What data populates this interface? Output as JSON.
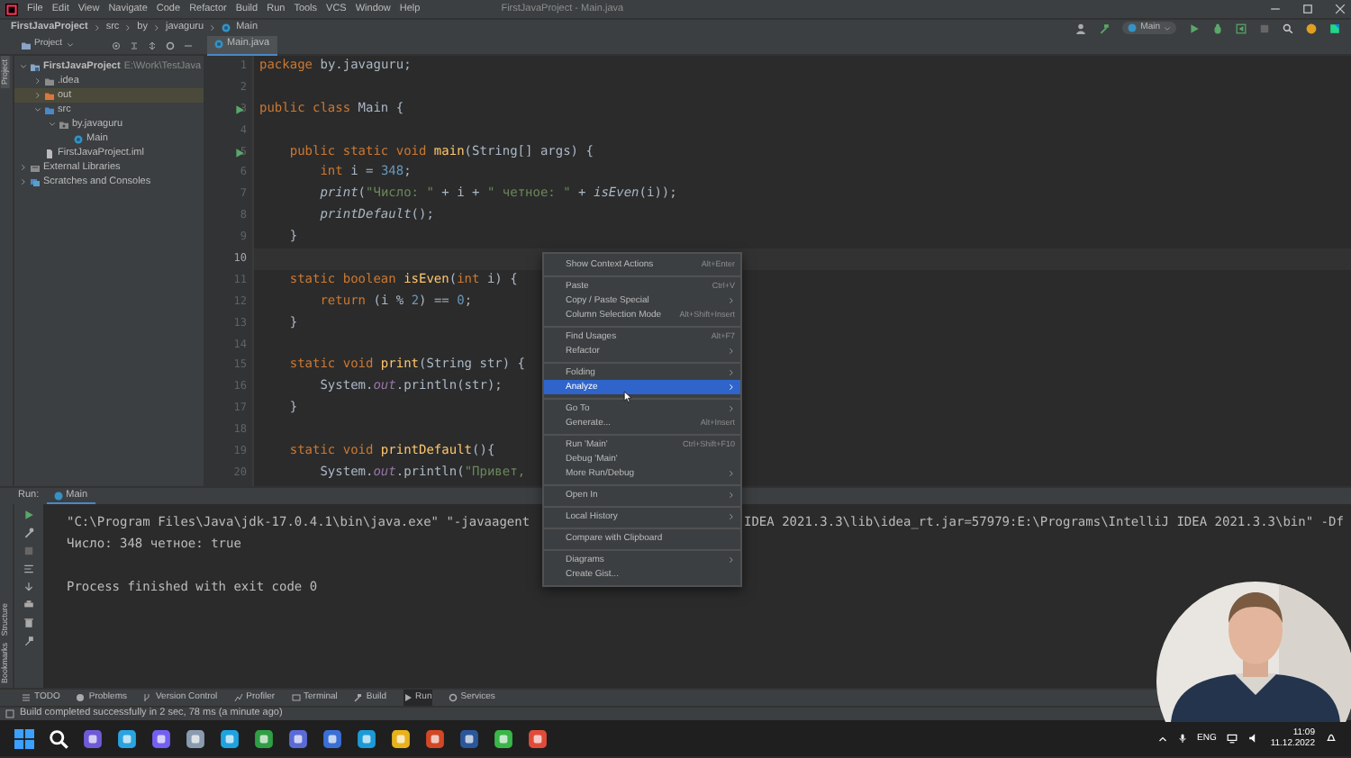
{
  "window": {
    "title": "FirstJavaProject - Main.java"
  },
  "menu": [
    "File",
    "Edit",
    "View",
    "Navigate",
    "Code",
    "Refactor",
    "Build",
    "Run",
    "Tools",
    "VCS",
    "Window",
    "Help"
  ],
  "breadcrumbs": [
    "FirstJavaProject",
    "src",
    "by",
    "javaguru",
    "Main"
  ],
  "run_config": "Main",
  "project_panel": {
    "label": "Project",
    "side_label": "Project",
    "tree": [
      {
        "name": "FirstJavaProject",
        "path": "E:\\Work\\TestJava",
        "kind": "module",
        "expanded": true,
        "selected": false,
        "children": [
          {
            "name": ".idea",
            "kind": "folder",
            "expanded": false,
            "selected": false
          },
          {
            "name": "out",
            "kind": "excluded",
            "expanded": false,
            "selected": true
          },
          {
            "name": "src",
            "kind": "source",
            "expanded": true,
            "selected": false,
            "children": [
              {
                "name": "by.javaguru",
                "kind": "package",
                "expanded": true,
                "selected": false,
                "children": [
                  {
                    "name": "Main",
                    "kind": "class",
                    "selected": false
                  }
                ]
              }
            ]
          },
          {
            "name": "FirstJavaProject.iml",
            "kind": "file",
            "selected": false
          }
        ]
      },
      {
        "name": "External Libraries",
        "kind": "library",
        "expanded": false,
        "selected": false
      },
      {
        "name": "Scratches and Consoles",
        "kind": "scratch",
        "expanded": false,
        "selected": false
      }
    ]
  },
  "editor": {
    "tab": {
      "label": "Main.java",
      "selected": true
    },
    "lines": [
      {
        "number": "1",
        "current": false,
        "run": false,
        "code": [
          {
            "kind": "kw",
            "text": "package"
          },
          {
            "kind": "plain",
            "text": " by.javaguru;"
          }
        ]
      },
      {
        "number": "2",
        "current": false,
        "run": false
      },
      {
        "number": "3",
        "current": false,
        "run": true,
        "code": [
          {
            "kind": "kw",
            "text": "public class"
          },
          {
            "kind": "plain",
            "text": " Main {"
          }
        ]
      },
      {
        "number": "4",
        "current": false,
        "run": false
      },
      {
        "number": "5",
        "current": false,
        "run": true,
        "code": [
          {
            "kind": "kw",
            "text": "    public static void"
          },
          {
            "kind": "fn",
            "text": " main"
          },
          {
            "kind": "plain",
            "text": "(String[] args) {"
          }
        ]
      },
      {
        "number": "6",
        "current": false,
        "run": false,
        "code": [
          {
            "kind": "kw",
            "text": "        int"
          },
          {
            "kind": "plain",
            "text": " i = "
          },
          {
            "kind": "num",
            "text": "348"
          },
          {
            "kind": "plain",
            "text": ";"
          }
        ]
      },
      {
        "number": "7",
        "current": false,
        "run": false,
        "code": [
          {
            "kind": "call",
            "text": "        print"
          },
          {
            "kind": "plain",
            "text": "("
          },
          {
            "kind": "str",
            "text": "\"Число: \""
          },
          {
            "kind": "plain",
            "text": " + i + "
          },
          {
            "kind": "str",
            "text": "\" четное: \""
          },
          {
            "kind": "plain",
            "text": " + "
          },
          {
            "kind": "call",
            "text": "isEven"
          },
          {
            "kind": "plain",
            "text": "(i));"
          }
        ]
      },
      {
        "number": "8",
        "current": false,
        "run": false,
        "code": [
          {
            "kind": "call",
            "text": "        printDefault"
          },
          {
            "kind": "plain",
            "text": "();"
          }
        ]
      },
      {
        "number": "9",
        "current": false,
        "run": false,
        "code": [
          {
            "kind": "plain",
            "text": "    }"
          }
        ]
      },
      {
        "number": "10",
        "current": true,
        "run": false
      },
      {
        "number": "11",
        "current": false,
        "run": false,
        "code": [
          {
            "kind": "kw",
            "text": "    static boolean"
          },
          {
            "kind": "fn",
            "text": " isEven"
          },
          {
            "kind": "plain",
            "text": "("
          },
          {
            "kind": "kw",
            "text": "int"
          },
          {
            "kind": "plain",
            "text": " i) {"
          }
        ]
      },
      {
        "number": "12",
        "current": false,
        "run": false,
        "code": [
          {
            "kind": "kw",
            "text": "        return"
          },
          {
            "kind": "plain",
            "text": " (i % "
          },
          {
            "kind": "num",
            "text": "2"
          },
          {
            "kind": "plain",
            "text": ") == "
          },
          {
            "kind": "num",
            "text": "0"
          },
          {
            "kind": "plain",
            "text": ";"
          }
        ]
      },
      {
        "number": "13",
        "current": false,
        "run": false,
        "code": [
          {
            "kind": "plain",
            "text": "    }"
          }
        ]
      },
      {
        "number": "14",
        "current": false,
        "run": false
      },
      {
        "number": "15",
        "current": false,
        "run": false,
        "code": [
          {
            "kind": "kw",
            "text": "    static void"
          },
          {
            "kind": "fn",
            "text": " print"
          },
          {
            "kind": "plain",
            "text": "(String str) {"
          }
        ]
      },
      {
        "number": "16",
        "current": false,
        "run": false,
        "code": [
          {
            "kind": "plain",
            "text": "        System."
          },
          {
            "kind": "field",
            "text": "out"
          },
          {
            "kind": "plain",
            "text": ".println(str);"
          }
        ]
      },
      {
        "number": "17",
        "current": false,
        "run": false,
        "code": [
          {
            "kind": "plain",
            "text": "    }"
          }
        ]
      },
      {
        "number": "18",
        "current": false,
        "run": false
      },
      {
        "number": "19",
        "current": false,
        "run": false,
        "code": [
          {
            "kind": "kw",
            "text": "    static void"
          },
          {
            "kind": "fn",
            "text": " printDefault"
          },
          {
            "kind": "plain",
            "text": "(){"
          }
        ]
      },
      {
        "number": "20",
        "current": false,
        "run": false,
        "code": [
          {
            "kind": "plain",
            "text": "        System."
          },
          {
            "kind": "field",
            "text": "out"
          },
          {
            "kind": "plain",
            "text": ".println("
          },
          {
            "kind": "str",
            "text": "\"Привет, "
          }
        ]
      }
    ]
  },
  "context_menu": {
    "items": [
      {
        "kind": "item",
        "label": "Show Context Actions",
        "shortcut": "Alt+Enter",
        "submenu": false,
        "selected": false
      },
      {
        "kind": "separator"
      },
      {
        "kind": "item",
        "label": "Paste",
        "shortcut": "Ctrl+V",
        "submenu": false,
        "selected": false
      },
      {
        "kind": "item",
        "label": "Copy / Paste Special",
        "submenu": true,
        "selected": false
      },
      {
        "kind": "item",
        "label": "Column Selection Mode",
        "shortcut": "Alt+Shift+Insert",
        "submenu": false,
        "selected": false
      },
      {
        "kind": "separator"
      },
      {
        "kind": "item",
        "label": "Find Usages",
        "shortcut": "Alt+F7",
        "submenu": false,
        "selected": false
      },
      {
        "kind": "item",
        "label": "Refactor",
        "submenu": true,
        "selected": false
      },
      {
        "kind": "separator"
      },
      {
        "kind": "item",
        "label": "Folding",
        "submenu": true,
        "selected": false
      },
      {
        "kind": "item",
        "label": "Analyze",
        "submenu": true,
        "selected": true
      },
      {
        "kind": "separator"
      },
      {
        "kind": "item",
        "label": "Go To",
        "submenu": true,
        "selected": false
      },
      {
        "kind": "item",
        "label": "Generate...",
        "shortcut": "Alt+Insert",
        "submenu": false,
        "selected": false
      },
      {
        "kind": "separator"
      },
      {
        "kind": "item",
        "label": "Run 'Main'",
        "shortcut": "Ctrl+Shift+F10",
        "submenu": false,
        "selected": false
      },
      {
        "kind": "item",
        "label": "Debug 'Main'",
        "submenu": false,
        "selected": false
      },
      {
        "kind": "item",
        "label": "More Run/Debug",
        "submenu": true,
        "selected": false
      },
      {
        "kind": "separator"
      },
      {
        "kind": "item",
        "label": "Open In",
        "submenu": true,
        "selected": false
      },
      {
        "kind": "separator"
      },
      {
        "kind": "item",
        "label": "Local History",
        "submenu": true,
        "selected": false
      },
      {
        "kind": "separator"
      },
      {
        "kind": "item",
        "label": "Compare with Clipboard",
        "submenu": false,
        "selected": false
      },
      {
        "kind": "separator"
      },
      {
        "kind": "item",
        "label": "Diagrams",
        "submenu": true,
        "selected": false
      },
      {
        "kind": "item",
        "label": "Create Gist...",
        "submenu": false,
        "selected": false
      }
    ]
  },
  "run_panel": {
    "label": "Run:",
    "tab": "Main",
    "side_labels": [
      "Structure",
      "Bookmarks"
    ],
    "output": [
      {
        "parts": [
          "\"C:\\Program Files\\Java\\jdk-17.0.4.1\\bin\\java.exe\" \"-javaagent",
          "IDEA 2021.3.3\\lib\\idea_rt.jar=57979:E:\\Programs\\IntelliJ IDEA 2021.3.3\\bin\" -Df"
        ]
      },
      {
        "parts": [
          "Число: 348 четное: true"
        ]
      }
    ],
    "exit_message": "Process finished with exit code 0"
  },
  "tool_tabs": [
    {
      "label": "TODO",
      "selected": false
    },
    {
      "label": "Problems",
      "selected": false
    },
    {
      "label": "Version Control",
      "selected": false
    },
    {
      "label": "Profiler",
      "selected": false
    },
    {
      "label": "Terminal",
      "selected": false
    },
    {
      "label": "Build",
      "selected": false
    },
    {
      "label": "Run",
      "selected": true
    },
    {
      "label": "Services",
      "selected": false
    }
  ],
  "status_bar": {
    "message": "Build completed successfully in 2 sec, 78 ms (a minute ago)"
  },
  "taskbar": {
    "apps": [
      {
        "color": "#6f5bd8"
      },
      {
        "color": "#2aa3e0"
      },
      {
        "color": "#7360f2"
      },
      {
        "color": "#8a9bb0"
      },
      {
        "color": "#1fa3e0"
      },
      {
        "color": "#2f9e44"
      },
      {
        "color": "#5b6bd6"
      },
      {
        "color": "#3a6fd6"
      },
      {
        "color": "#1c9ad6"
      },
      {
        "color": "#e8b21c"
      },
      {
        "color": "#d24726"
      },
      {
        "color": "#2b579a"
      },
      {
        "color": "#3ab54a"
      },
      {
        "color": "#e04c3a"
      }
    ],
    "language": "ENG",
    "time": "11:09",
    "date": "11.12.2022"
  },
  "webcam": {
    "kind": "picture"
  }
}
